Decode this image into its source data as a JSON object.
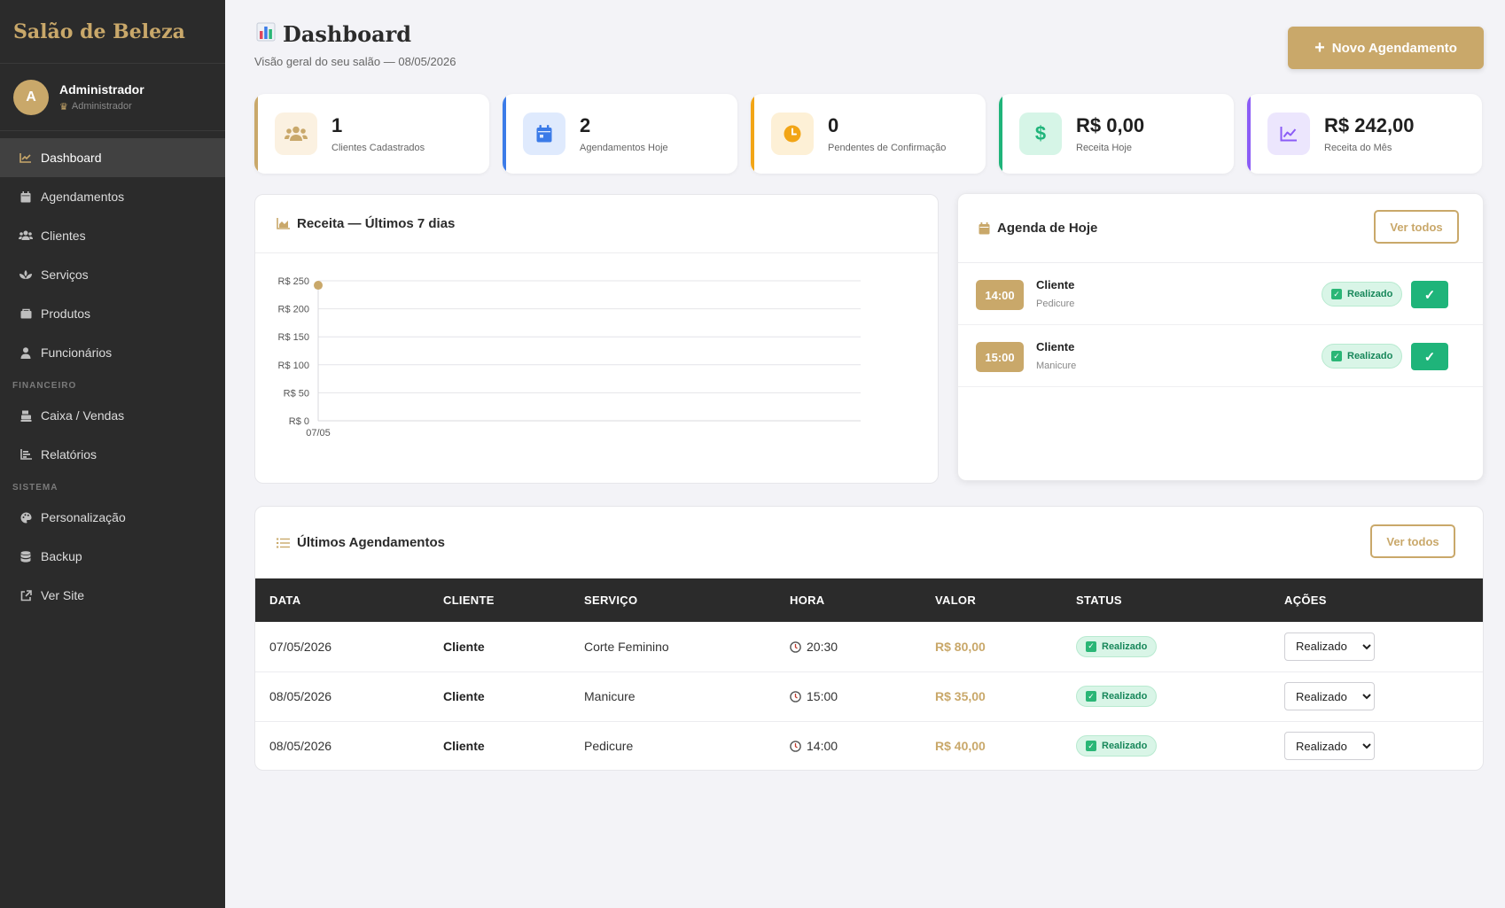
{
  "brand": "Salão de Beleza",
  "user": {
    "initial": "A",
    "name": "Administrador",
    "role": "Administrador"
  },
  "nav": {
    "items": [
      {
        "label": "Dashboard",
        "icon": "chart-line-icon",
        "active": true
      },
      {
        "label": "Agendamentos",
        "icon": "calendar-icon"
      },
      {
        "label": "Clientes",
        "icon": "users-icon"
      },
      {
        "label": "Serviços",
        "icon": "spa-icon"
      },
      {
        "label": "Produtos",
        "icon": "box-icon"
      },
      {
        "label": "Funcionários",
        "icon": "user-tie-icon"
      }
    ],
    "section_financeiro": "FINANCEIRO",
    "financeiro": [
      {
        "label": "Caixa / Vendas",
        "icon": "cash-register-icon"
      },
      {
        "label": "Relatórios",
        "icon": "chart-bar-icon"
      }
    ],
    "section_sistema": "SISTEMA",
    "sistema": [
      {
        "label": "Personalização",
        "icon": "palette-icon"
      },
      {
        "label": "Backup",
        "icon": "database-icon"
      },
      {
        "label": "Ver Site",
        "icon": "external-link-icon"
      }
    ]
  },
  "header": {
    "title": "Dashboard",
    "subtitle": "Visão geral do seu salão — 08/05/2026",
    "new_button": "Novo Agendamento"
  },
  "stats": [
    {
      "value": "1",
      "label": "Clientes Cadastrados",
      "color": "#c9a86a"
    },
    {
      "value": "2",
      "label": "Agendamentos Hoje",
      "color": "#3b7be8"
    },
    {
      "value": "0",
      "label": "Pendentes de Confirmação",
      "color": "#f2a516"
    },
    {
      "value": "R$ 0,00",
      "label": "Receita Hoje",
      "color": "#1fb47a"
    },
    {
      "value": "R$ 242,00",
      "label": "Receita do Mês",
      "color": "#8b5cf6"
    }
  ],
  "revenue": {
    "title": "Receita — Últimos 7 dias"
  },
  "chart_data": {
    "type": "line",
    "title": "Receita — Últimos 7 dias",
    "categories": [
      "07/05"
    ],
    "series": [
      {
        "values": [
          242
        ]
      }
    ],
    "yticks": [
      "R$ 0",
      "R$ 50",
      "R$ 100",
      "R$ 150",
      "R$ 200",
      "R$ 250"
    ],
    "ylim": [
      0,
      250
    ],
    "grid": true,
    "color": "#c9a86a"
  },
  "agenda": {
    "title": "Agenda de Hoje",
    "view_all": "Ver todos",
    "items": [
      {
        "time": "14:00",
        "client": "Cliente",
        "service": "Pedicure",
        "status": "Realizado",
        "action": "✓"
      },
      {
        "time": "15:00",
        "client": "Cliente",
        "service": "Manicure",
        "status": "Realizado",
        "action": "✓"
      }
    ]
  },
  "latest": {
    "title": "Últimos Agendamentos",
    "view_all": "Ver todos",
    "columns": [
      "DATA",
      "CLIENTE",
      "SERVIÇO",
      "HORA",
      "VALOR",
      "STATUS",
      "AÇÕES"
    ],
    "rows": [
      {
        "date": "07/05/2026",
        "client": "Cliente",
        "service": "Corte Feminino",
        "time": "20:30",
        "value": "R$ 80,00",
        "status": "Realizado",
        "action": "Realizado"
      },
      {
        "date": "08/05/2026",
        "client": "Cliente",
        "service": "Manicure",
        "time": "15:00",
        "value": "R$ 35,00",
        "status": "Realizado",
        "action": "Realizado"
      },
      {
        "date": "08/05/2026",
        "client": "Cliente",
        "service": "Pedicure",
        "time": "14:00",
        "value": "R$ 40,00",
        "status": "Realizado",
        "action": "Realizado"
      }
    ]
  }
}
